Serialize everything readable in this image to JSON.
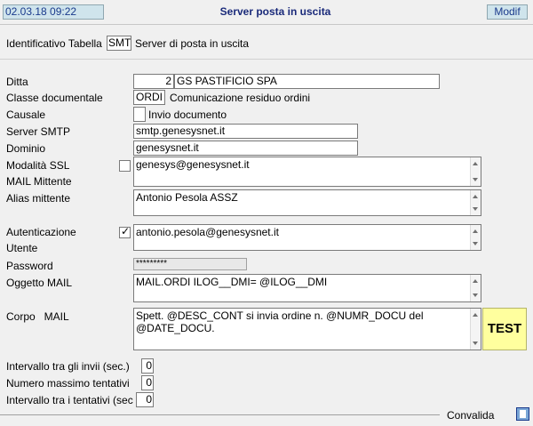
{
  "header": {
    "datetime": "02.03.18 09:22",
    "title": "Server posta in uscita",
    "mode_button": "Modif"
  },
  "table_id": {
    "label": "Identificativo Tabella",
    "value": "SMT",
    "description": "Server di posta in uscita"
  },
  "form": {
    "ditta": {
      "label": "Ditta",
      "code": "2",
      "name": "GS PASTIFICIO SPA"
    },
    "classe": {
      "label": "Classe documentale",
      "code": "ORDI",
      "description": "Comunicazione residuo ordini"
    },
    "causale": {
      "label": "Causale",
      "description": "Invio documento"
    },
    "server_smtp": {
      "label": "Server SMTP",
      "value": "smtp.genesysnet.it"
    },
    "dominio": {
      "label": "Dominio",
      "value": "genesysnet.it"
    },
    "ssl": {
      "label": "Modalità SSL",
      "checked": false
    },
    "mail_mittente": {
      "label": "MAIL Mittente",
      "value": "genesys@genesysnet.it"
    },
    "alias": {
      "label": "Alias mittente",
      "value": "Antonio Pesola ASSZ"
    },
    "autenticazione": {
      "label": "Autenticazione",
      "checked": true
    },
    "utente": {
      "label": "Utente",
      "value": "antonio.pesola@genesysnet.it"
    },
    "password": {
      "label": "Password",
      "value": "*********"
    },
    "oggetto": {
      "label": "Oggetto MAIL",
      "value": "MAIL.ORDI ILOG__DMI= @ILOG__DMI"
    },
    "corpo": {
      "label": "Corpo   MAIL",
      "value": "Spett. @DESC_CONT si invia ordine n. @NUMR_DOCU del @DATE_DOCU."
    },
    "test_button": "TEST",
    "intervallo_invii": {
      "label": "Intervallo tra gli invii (sec.)",
      "value": "0"
    },
    "max_tentativi": {
      "label": "Numero massimo tentativi",
      "value": "0"
    },
    "intervallo_tentativi": {
      "label": "Intervallo tra i tentativi (sec",
      "value": "0"
    }
  },
  "footer": {
    "convalida_label": "Convalida"
  }
}
